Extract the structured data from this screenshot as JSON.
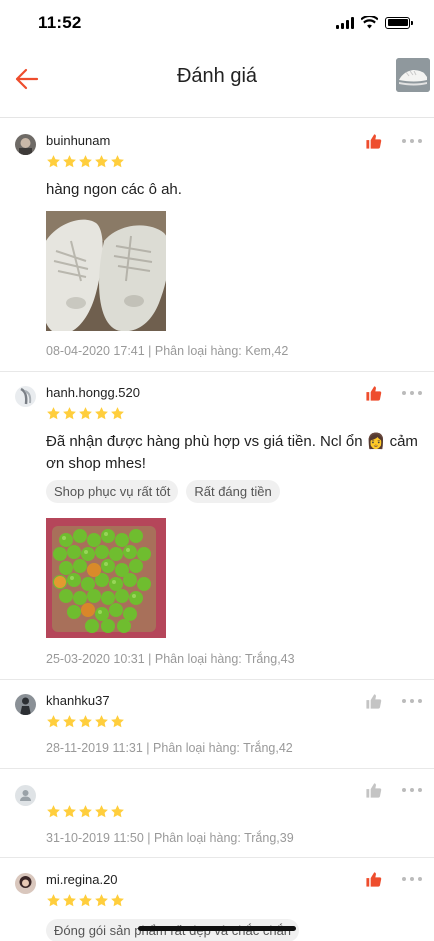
{
  "status_bar": {
    "time": "11:52"
  },
  "header": {
    "title": "Đánh giá"
  },
  "reviews": [
    {
      "username": "buinhunam",
      "rating": 5,
      "liked": true,
      "text": "hàng ngon các ô ah.",
      "meta": "08-04-2020 17:41 | Phân loại hàng: Kem,42"
    },
    {
      "username": "hanh.hongg.520",
      "rating": 5,
      "liked": true,
      "text": "Đã nhận được hàng phù hợp vs giá tiền. Ncl ổn 👩 cảm ơn shop mhes!",
      "tags": [
        "Shop phục vụ rất tốt",
        "Rất đáng tiền"
      ],
      "meta": "25-03-2020 10:31 | Phân loại hàng: Trắng,43"
    },
    {
      "username": "khanhku37",
      "rating": 5,
      "liked": false,
      "meta": "28-11-2019 11:31 | Phân loại hàng: Trắng,42"
    },
    {
      "username": "",
      "rating": 5,
      "liked": false,
      "meta": "31-10-2019 11:50 | Phân loại hàng: Trắng,39"
    },
    {
      "username": "mi.regina.20",
      "rating": 5,
      "liked": true,
      "tags": [
        "Đóng gói sản phẩm rất đẹp và chắc chắn"
      ]
    }
  ],
  "colors": {
    "accent": "#ee4d2d",
    "star": "#ffce3d",
    "like_inactive": "#c4c4c4"
  }
}
